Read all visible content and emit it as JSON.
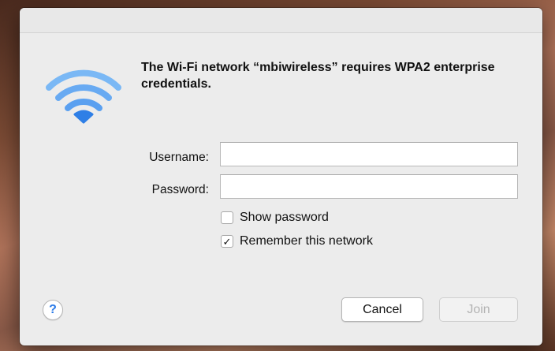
{
  "dialog": {
    "message": "The Wi-Fi network “mbiwireless” requires WPA2 enterprise credentials.",
    "icon": "wifi-icon",
    "accent_color": "#4a9bf0"
  },
  "form": {
    "username_label": "Username:",
    "username_value": "",
    "password_label": "Password:",
    "password_value": ""
  },
  "options": {
    "show_password_label": "Show password",
    "show_password_checked": false,
    "remember_label": "Remember this network",
    "remember_checked": true,
    "check_mark": "✓"
  },
  "buttons": {
    "help_label": "?",
    "cancel_label": "Cancel",
    "join_label": "Join",
    "join_enabled": false
  }
}
